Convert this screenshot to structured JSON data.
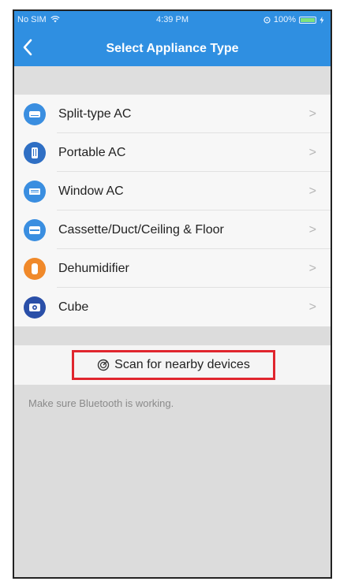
{
  "status_bar": {
    "carrier": "No SIM",
    "time": "4:39 PM",
    "battery": "100%"
  },
  "nav": {
    "back_glyph": "<",
    "title": "Select Appliance Type"
  },
  "appliances": [
    {
      "label": "Split-type AC",
      "icon": "split-ac-icon",
      "color": "#3a8ee0"
    },
    {
      "label": "Portable AC",
      "icon": "portable-ac-icon",
      "color": "#2f6fc4"
    },
    {
      "label": "Window AC",
      "icon": "window-ac-icon",
      "color": "#3a8ee0"
    },
    {
      "label": "Cassette/Duct/Ceiling & Floor",
      "icon": "cassette-ac-icon",
      "color": "#3a8ee0"
    },
    {
      "label": "Dehumidifier",
      "icon": "dehumidifier-icon",
      "color": "#f0892a"
    },
    {
      "label": "Cube",
      "icon": "cube-icon",
      "color": "#2a4fa8"
    }
  ],
  "chevron": ">",
  "scan": {
    "label": "Scan for nearby devices",
    "icon": "scan-icon"
  },
  "hint": "Make sure Bluetooth is working.",
  "colors": {
    "header": "#2f8fe1",
    "highlight": "#e0262e"
  }
}
